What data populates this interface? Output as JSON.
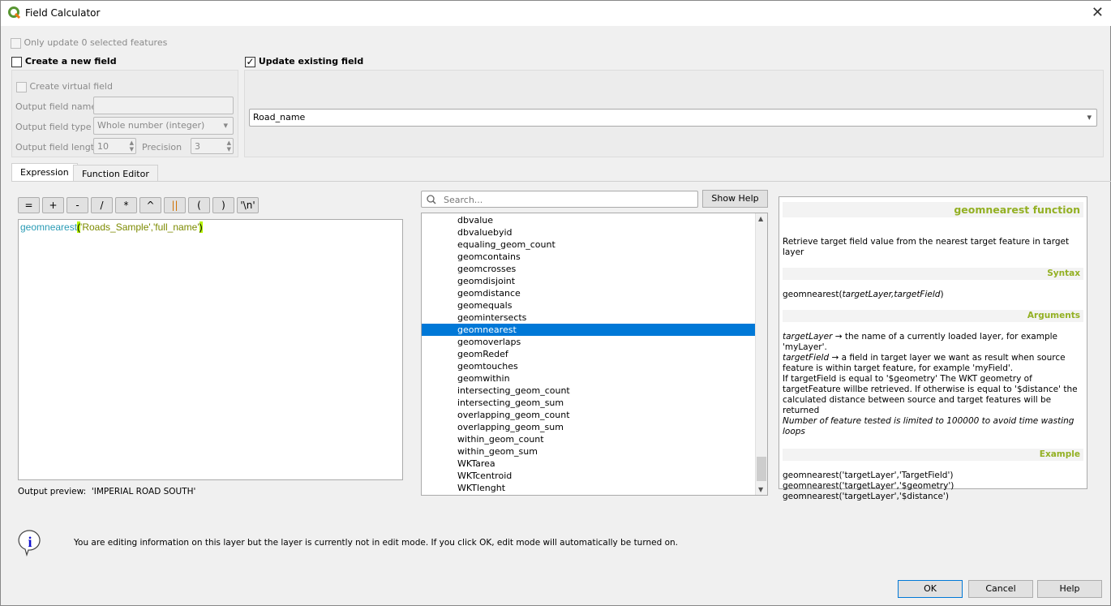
{
  "window": {
    "title": "Field Calculator",
    "close": "✕"
  },
  "only_update": "Only update 0 selected features",
  "create_new": {
    "label": "Create a new field",
    "checked": false,
    "virtual_label": "Create virtual field",
    "name_label": "Output field name",
    "type_label": "Output field type",
    "type_value": "Whole number (integer)",
    "length_label": "Output field length",
    "length_value": "10",
    "precision_label": "Precision",
    "precision_value": "3"
  },
  "update_existing": {
    "label": "Update existing field",
    "checked": true,
    "value": "Road_name"
  },
  "tabs": [
    "Expression",
    "Function Editor"
  ],
  "operators": [
    "=",
    "+",
    "-",
    "/",
    "*",
    "^",
    "||",
    "(",
    ")",
    "'\\n'"
  ],
  "expression": {
    "func": "geomnearest",
    "open": "(",
    "args": "'Roads_Sample','full_name'",
    "close": ")"
  },
  "output_preview": {
    "label": "Output preview:",
    "value": "'IMPERIAL ROAD SOUTH'"
  },
  "search": {
    "placeholder": "Search...",
    "show_help": "Show Help"
  },
  "functions": [
    "dbvalue",
    "dbvaluebyid",
    "equaling_geom_count",
    "geomcontains",
    "geomcrosses",
    "geomdisjoint",
    "geomdistance",
    "geomequals",
    "geomintersects",
    "geomnearest",
    "geomoverlaps",
    "geomRedef",
    "geomtouches",
    "geomwithin",
    "intersecting_geom_count",
    "intersecting_geom_sum",
    "overlapping_geom_count",
    "overlapping_geom_sum",
    "within_geom_count",
    "within_geom_sum",
    "WKTarea",
    "WKTcentroid",
    "WKTlenght"
  ],
  "selected_function": "geomnearest",
  "help": {
    "title": "geomnearest function",
    "description": "Retrieve target field value from the nearest target feature in target layer",
    "syntax_h": "Syntax",
    "syntax_name": "geomnearest(",
    "syntax_args": "targetLayer,targetField",
    "syntax_close": ")",
    "args_h": "Arguments",
    "arg1_name": "targetLayer",
    "arg1_text": " → the name of a currently loaded layer, for example 'myLayer'.",
    "arg2_name": "targetField",
    "arg2_text": " → a field in target layer we want as result when source feature is within target feature, for example 'myField'.",
    "arg_note": "If targetField is equal to '$geometry' The WKT geometry of targetFeature willbe retrieved. If otherwise is equal to '$distance' the calculated distance between source and target features will be returned",
    "arg_limit": "Number of feature tested is limited to 100000 to avoid time wasting loops",
    "example_h": "Example",
    "examples": [
      "geomnearest('targetLayer','TargetField')",
      "geomnearest('targetLayer','$geometry')",
      "geomnearest('targetLayer','$distance')"
    ]
  },
  "message": "You are editing information on this layer but the layer is currently not in edit mode. If you click OK, edit mode will automatically be turned on.",
  "buttons": {
    "ok": "OK",
    "cancel": "Cancel",
    "help": "Help"
  },
  "colors": {
    "accent": "#0078d7",
    "help_heading": "#93b023",
    "func_color": "#2a9bb5",
    "string_color": "#7c8a00",
    "bracket_highlight": "#b7f500"
  }
}
